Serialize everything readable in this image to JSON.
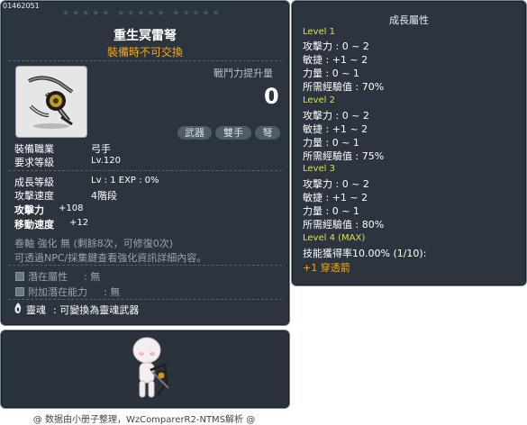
{
  "item": {
    "id": "01462051",
    "stars": "★★★★★  ★★★★★  ★★★★★",
    "name": "重生冥雷弩",
    "trade_note": "裝備時不可交換",
    "combat_power_label": "戰鬥力提升量",
    "combat_power_value": "0",
    "tags": [
      "武器",
      "雙手",
      "弩"
    ]
  },
  "requirements": [
    {
      "label": "裝備職業",
      "value": "弓手"
    },
    {
      "label": "要求等級",
      "value": "Lv.120"
    }
  ],
  "growth": {
    "label": "成長等級",
    "value": "Lv : 1   EXP : 0%"
  },
  "stats": [
    {
      "label": "攻擊速度",
      "value": "4階段"
    },
    {
      "label": "攻擊力",
      "value": "+108"
    },
    {
      "label": "移動速度",
      "value": "+12"
    }
  ],
  "scroll": {
    "line1": "卷軸 強化 無 (剩餘8次，可修復0次)",
    "line2": "可透過NPC/採集鍵查看強化資訊詳細內容。"
  },
  "potentials": [
    {
      "label": "潛在屬性",
      "value": ": 無"
    },
    {
      "label": "附加潛在能力",
      "value": ": 無"
    }
  ],
  "soul": {
    "label": "靈魂",
    "value": ": 可變換為靈魂武器"
  },
  "side": {
    "title": "成長屬性",
    "levels": [
      {
        "name": "Level 1",
        "lines": [
          "攻擊力 : 0 ~ 2",
          "敏捷 : +1 ~ 2",
          "力量 : 0 ~ 1",
          "所需經驗值 : 70%"
        ]
      },
      {
        "name": "Level 2",
        "lines": [
          "攻擊力 : 0 ~ 2",
          "敏捷 : +1 ~ 2",
          "力量 : 0 ~ 1",
          "所需經驗值 : 75%"
        ]
      },
      {
        "name": "Level 3",
        "lines": [
          "攻擊力 : 0 ~ 2",
          "敏捷 : +1 ~ 2",
          "力量 : 0 ~ 1",
          "所需經驗值 : 80%"
        ]
      },
      {
        "name": "Level 4 (MAX)",
        "lines": [
          "技能獲得率10.00% (1/10):"
        ]
      }
    ],
    "skill": "+1 穿透箭"
  },
  "footer": "@ 数据由小册子整理，WzComparerR2-NTMS解析 @",
  "colors": {
    "panel_bg": "#2c3440",
    "accent_orange": "#ffaa00",
    "level_yellow": "#dfe050"
  }
}
